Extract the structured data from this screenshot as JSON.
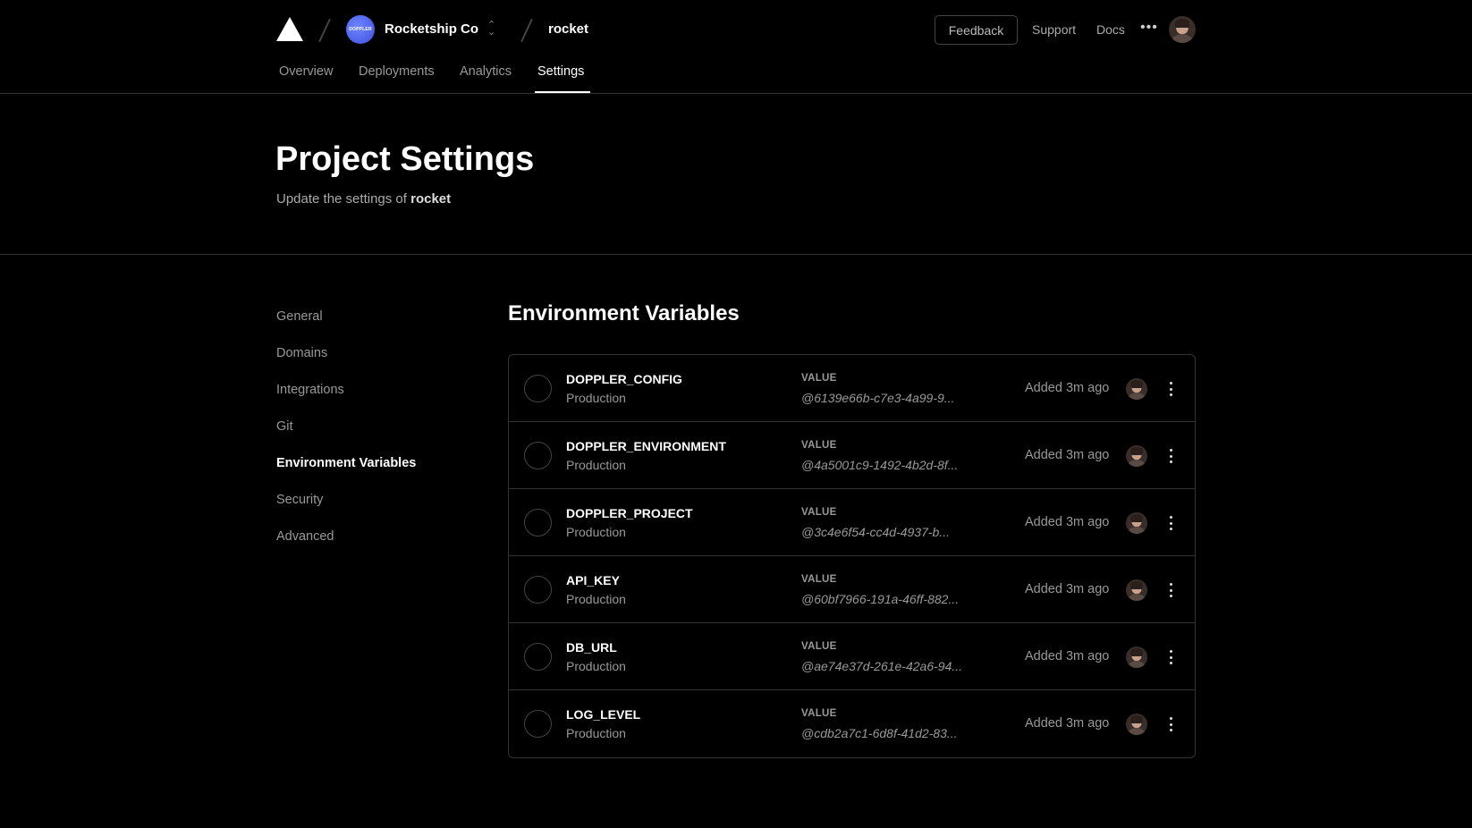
{
  "header": {
    "org_name": "Rocketship Co",
    "org_avatar_text": "DOPPLER",
    "project_name": "rocket",
    "feedback_label": "Feedback",
    "support_label": "Support",
    "docs_label": "Docs",
    "more_label": "•••"
  },
  "tabs": [
    {
      "label": "Overview"
    },
    {
      "label": "Deployments"
    },
    {
      "label": "Analytics"
    },
    {
      "label": "Settings"
    }
  ],
  "page": {
    "title": "Project Settings",
    "subtitle_prefix": "Update the settings of ",
    "subtitle_project": "rocket"
  },
  "sidenav": [
    {
      "label": "General"
    },
    {
      "label": "Domains"
    },
    {
      "label": "Integrations"
    },
    {
      "label": "Git"
    },
    {
      "label": "Environment Variables"
    },
    {
      "label": "Security"
    },
    {
      "label": "Advanced"
    }
  ],
  "env": {
    "section_title": "Environment Variables",
    "value_label": "VALUE",
    "rows": [
      {
        "name": "DOPPLER_CONFIG",
        "target": "Production",
        "value": "@6139e66b-c7e3-4a99-9...",
        "added": "Added 3m ago"
      },
      {
        "name": "DOPPLER_ENVIRONMENT",
        "target": "Production",
        "value": "@4a5001c9-1492-4b2d-8f...",
        "added": "Added 3m ago"
      },
      {
        "name": "DOPPLER_PROJECT",
        "target": "Production",
        "value": "@3c4e6f54-cc4d-4937-b...",
        "added": "Added 3m ago"
      },
      {
        "name": "API_KEY",
        "target": "Production",
        "value": "@60bf7966-191a-46ff-882...",
        "added": "Added 3m ago"
      },
      {
        "name": "DB_URL",
        "target": "Production",
        "value": "@ae74e37d-261e-42a6-94...",
        "added": "Added 3m ago"
      },
      {
        "name": "LOG_LEVEL",
        "target": "Production",
        "value": "@cdb2a7c1-6d8f-41d2-83...",
        "added": "Added 3m ago"
      }
    ]
  },
  "colors": {
    "background": "#000000",
    "border": "#333333",
    "text_primary": "#ffffff",
    "text_secondary": "#999999",
    "org_accent": "#5468ff"
  }
}
